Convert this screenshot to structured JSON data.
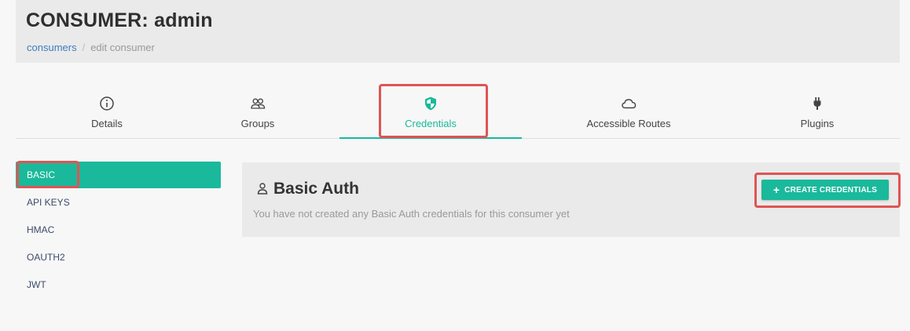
{
  "header": {
    "title": "CONSUMER: admin",
    "breadcrumb": {
      "link": "consumers",
      "separator": "/",
      "current": "edit consumer"
    }
  },
  "tabs": [
    {
      "label": "Details",
      "icon": "info-icon"
    },
    {
      "label": "Groups",
      "icon": "users-icon"
    },
    {
      "label": "Credentials",
      "icon": "shield-icon",
      "active": true
    },
    {
      "label": "Accessible Routes",
      "icon": "cloud-icon"
    },
    {
      "label": "Plugins",
      "icon": "plug-icon"
    }
  ],
  "sidebar": {
    "items": [
      {
        "label": "BASIC",
        "active": true
      },
      {
        "label": "API KEYS"
      },
      {
        "label": "HMAC"
      },
      {
        "label": "OAUTH2"
      },
      {
        "label": "JWT"
      }
    ]
  },
  "panel": {
    "title": "Basic Auth",
    "icon": "user-icon",
    "message": "You have not created any Basic Auth credentials for this consumer yet",
    "create_button": {
      "label": "CREATE CREDENTIALS",
      "icon": "plus-icon"
    }
  },
  "colors": {
    "accent": "#1ab99b",
    "highlight": "#e05454",
    "link": "#3f7ec1"
  }
}
